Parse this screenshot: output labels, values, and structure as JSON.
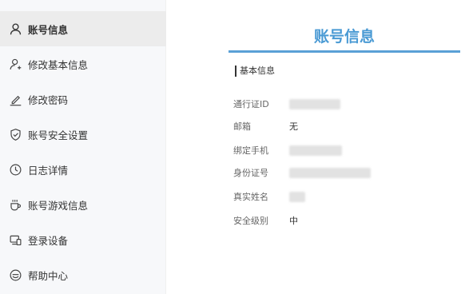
{
  "sidebar": {
    "items": [
      {
        "label": "账号信息",
        "icon": "user-icon",
        "active": true
      },
      {
        "label": "修改基本信息",
        "icon": "user-add-icon"
      },
      {
        "label": "修改密码",
        "icon": "pen-icon"
      },
      {
        "label": "账号安全设置",
        "icon": "shield-icon"
      },
      {
        "label": "日志详情",
        "icon": "clock-icon"
      },
      {
        "label": "账号游戏信息",
        "icon": "cup-icon"
      },
      {
        "label": "登录设备",
        "icon": "devices-icon"
      },
      {
        "label": "帮助中心",
        "icon": "help-icon"
      }
    ]
  },
  "main": {
    "title": "账号信息",
    "section_title": "基本信息",
    "fields": [
      {
        "label": "通行证ID",
        "value": ""
      },
      {
        "label": "邮箱",
        "value": "无"
      },
      {
        "label": "绑定手机",
        "value": ""
      },
      {
        "label": "身份证号",
        "value": ""
      },
      {
        "label": "真实姓名",
        "value": ""
      },
      {
        "label": "安全级别",
        "value": "中"
      }
    ]
  },
  "colors": {
    "accent": "#4a9ad4",
    "sidebar_bg": "#f7f8fa",
    "active_bg": "#ececec"
  }
}
